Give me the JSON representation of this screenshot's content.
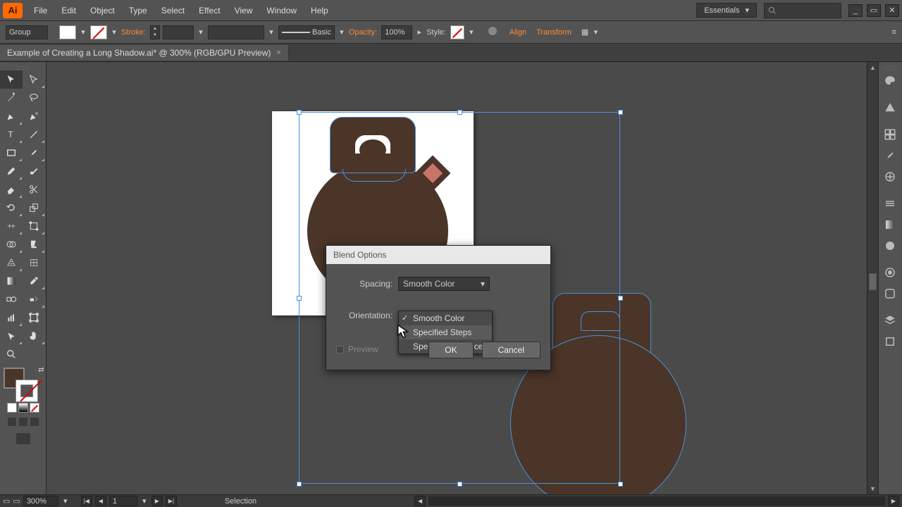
{
  "app": {
    "logo": "Ai"
  },
  "menu": {
    "items": [
      "File",
      "Edit",
      "Object",
      "Type",
      "Select",
      "Effect",
      "View",
      "Window",
      "Help"
    ]
  },
  "workspace_selector": "Essentials",
  "window_controls": {
    "min": "_",
    "max": "▭",
    "close": "✕"
  },
  "control": {
    "group": "Group",
    "stroke": "Stroke:",
    "brush_basic": "Basic",
    "opacity_label": "Opacity:",
    "opacity_value": "100%",
    "style_label": "Style:",
    "align": "Align",
    "transform": "Transform"
  },
  "doc": {
    "tab_title": "Example of Creating a Long Shadow.ai* @ 300% (RGB/GPU Preview)",
    "tab_close": "×"
  },
  "dialog": {
    "title": "Blend Options",
    "spacing_label": "Spacing:",
    "spacing_value": "Smooth Color",
    "orientation_label": "Orientation:",
    "preview": "Preview",
    "ok": "OK",
    "cancel": "Cancel",
    "dd_items": [
      "Smooth Color",
      "Specified Steps",
      "Specified Distance"
    ]
  },
  "status": {
    "zoom": "300%",
    "page": "1",
    "mode": "Selection"
  }
}
